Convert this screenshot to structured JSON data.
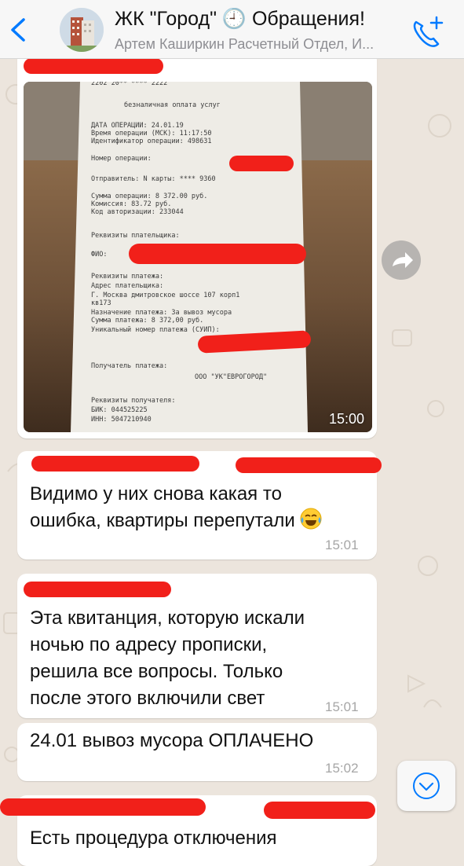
{
  "header": {
    "title": "ЖК \"Город\" 🕘 Обращения!",
    "subtitle": "Артем Каширкин Расчетный Отдел, И...",
    "back_icon": "chevron-left-icon",
    "call_icon": "add-call-icon",
    "accent": "#007aff"
  },
  "photo": {
    "time": "15:00",
    "receipt_lines": [
      "2202 20** **** 2222",
      "безналичная оплата услуг",
      "ДАТА ОПЕРАЦИИ: 24.01.19",
      "Время операции (МСК): 11:17:50",
      "Идентификатор операции: 498631",
      "Номер операции:",
      "Отправитель: N карты: **** 9360",
      "Сумма операции: 8 372.00 руб.",
      "Комиссия: 83.72 руб.",
      "Код авторизации: 233044",
      "Реквизиты плательщика:",
      "ФИО:",
      "Реквизиты платежа:",
      "Адрес плательщика:",
      "Г. Москва дмитровское шоссе 107 корп1",
      "кв173",
      "Назначение платежа: За вывоз мусора",
      "Сумма платежа: 8 372,00 руб.",
      "Уникальный номер платежа (СУИП):",
      "Получатель платежа:",
      "ООО \"УК\"ЕВРОГОРОД\"",
      "Реквизиты получателя:",
      "БИК: 044525225",
      "ИНН: 5047210940"
    ]
  },
  "messages": [
    {
      "text_lines": [
        "Видимо у них снова какая то",
        "ошибка, квартиры перепутали"
      ],
      "emoji": "face-with-tears-of-joy-icon",
      "time": "15:01"
    },
    {
      "text_lines": [
        "Эта квитанция, которую искали",
        "ночью по адресу  прописки,",
        "решила все вопросы. Только",
        "после этого включили  свет"
      ],
      "time": "15:01"
    },
    {
      "text_lines": [
        "24.01 вывоз  мусора  ОПЛАЧЕНО"
      ],
      "time": "15:02"
    },
    {
      "text_lines": [
        "Есть процедура отключения"
      ],
      "time": ""
    }
  ],
  "controls": {
    "forward_icon": "forward-arrow-icon",
    "scroll_icon": "chevron-down-circle-icon"
  },
  "colors": {
    "redaction": "#f1201a",
    "bubble": "#ffffff",
    "wallpaper": "#ece5dd"
  }
}
